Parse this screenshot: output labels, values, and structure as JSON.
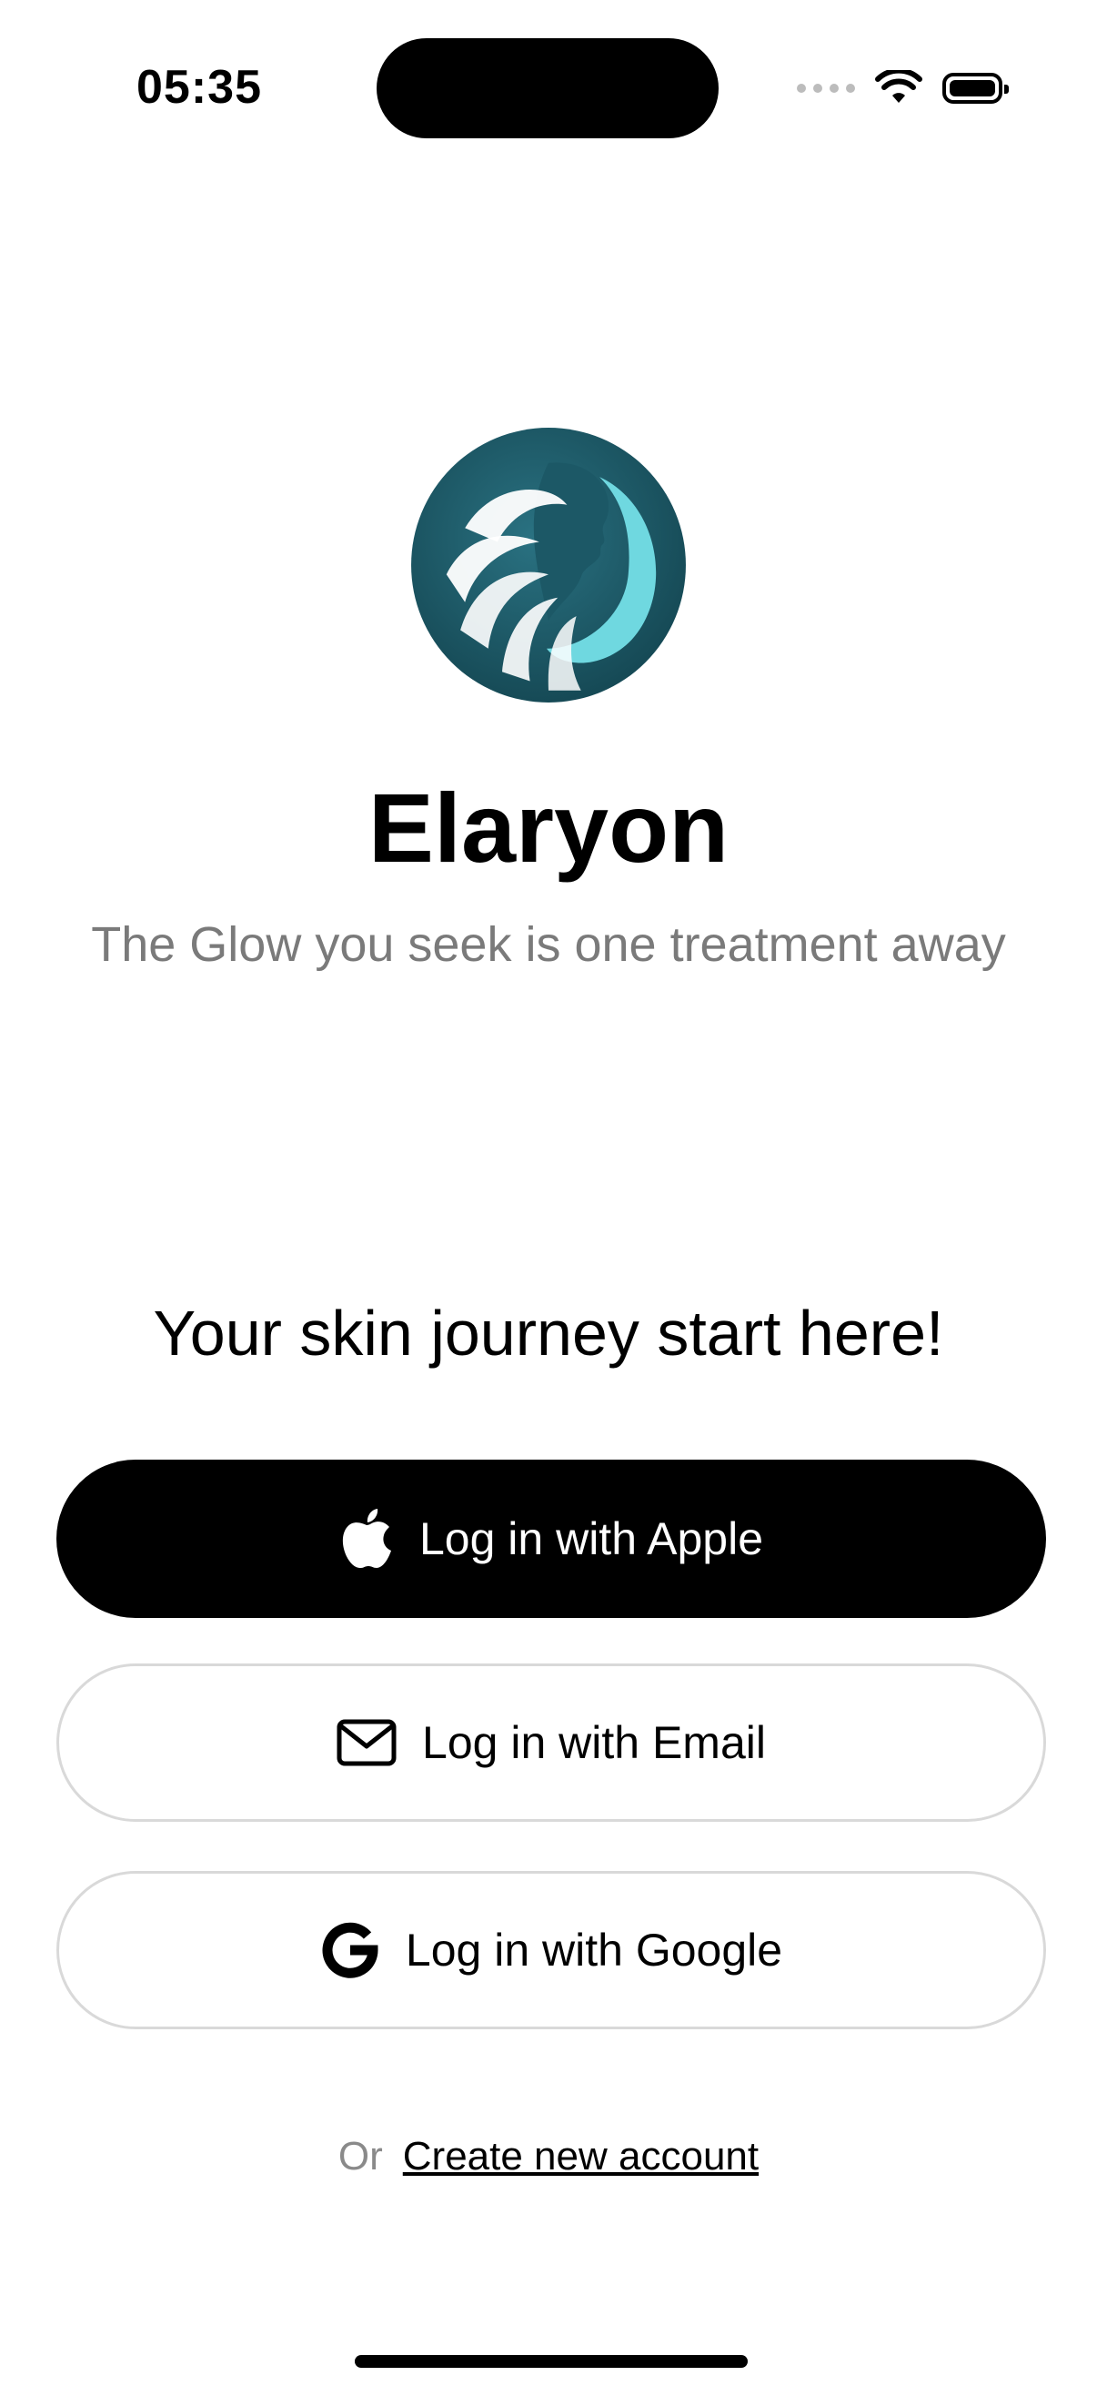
{
  "status_bar": {
    "time": "05:35"
  },
  "brand": {
    "name": "Elaryon",
    "tagline": "The Glow you seek is one treatment away",
    "colors": {
      "primary": "#1f5d6b",
      "accent": "#5fd3dd"
    }
  },
  "headline": "Your skin journey start here!",
  "buttons": {
    "apple": {
      "label": "Log in with Apple",
      "icon": "apple-icon"
    },
    "email": {
      "label": "Log in with Email",
      "icon": "envelope-icon"
    },
    "google": {
      "label": "Log in with Google",
      "icon": "google-icon"
    }
  },
  "signup": {
    "prefix": "Or",
    "link_label": "Create new account"
  }
}
